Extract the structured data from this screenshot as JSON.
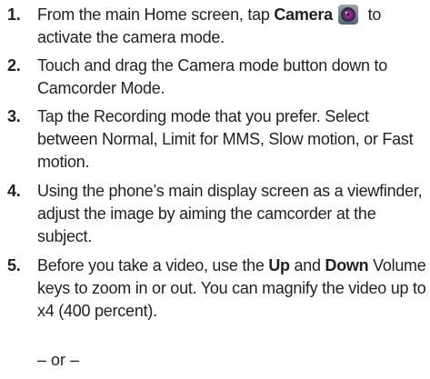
{
  "steps": [
    {
      "number": "1.",
      "lines": [
        {
          "pre": "From the main Home screen, tap ",
          "bold": "Camera",
          "post": " to",
          "icon": "camera-app-icon"
        },
        {
          "text": "activate the camera mode."
        }
      ]
    },
    {
      "number": "2.",
      "lines": [
        {
          "text": "Touch and drag the Camera mode button down to"
        },
        {
          "text": "Camcorder Mode."
        }
      ]
    },
    {
      "number": "3.",
      "lines": [
        {
          "text": "Tap the Recording mode that you prefer. Select"
        },
        {
          "text": "between Normal, Limit for MMS, Slow motion, or Fast"
        },
        {
          "text": "motion."
        }
      ]
    },
    {
      "number": "4.",
      "lines": [
        {
          "text": "Using the phone’s main display screen as a viewfinder,"
        },
        {
          "text": "adjust the image by aiming the camcorder at the"
        },
        {
          "text": "subject."
        }
      ]
    },
    {
      "number": "5.",
      "lines": [
        {
          "pre": "Before you take a video, use the ",
          "bold": "Up",
          "mid": " and ",
          "bold2": "Down",
          "post": " Volume"
        },
        {
          "text": "keys to zoom in or out. You can magnify the video up to"
        },
        {
          "text": "x4 (400 percent)."
        }
      ]
    }
  ],
  "or_text": "– or –"
}
